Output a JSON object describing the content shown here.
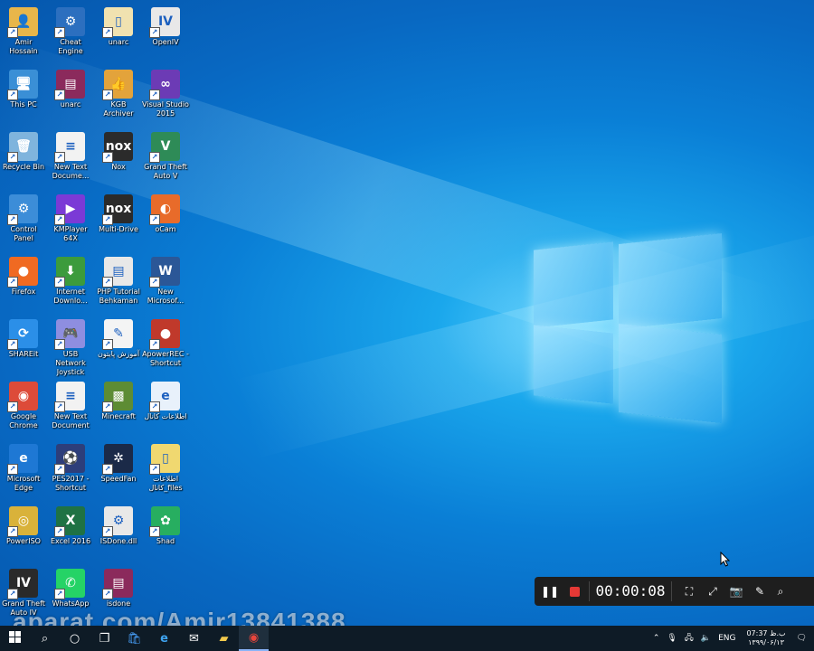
{
  "desktop": {
    "icons": [
      {
        "label": "Amir Hossain",
        "glyph": "👤",
        "color": "#e8b64a"
      },
      {
        "label": "This PC",
        "glyph": "🖥",
        "color": "#3a8fd6"
      },
      {
        "label": "Recycle Bin",
        "glyph": "🗑",
        "color": "#7fb4dd"
      },
      {
        "label": "Control Panel",
        "glyph": "⚙",
        "color": "#3c8dd8"
      },
      {
        "label": "Firefox",
        "glyph": "●",
        "color": "#f06a22"
      },
      {
        "label": "SHAREit",
        "glyph": "⟳",
        "color": "#2b8fe8"
      },
      {
        "label": "Google Chrome",
        "glyph": "◉",
        "color": "#dd4b39"
      },
      {
        "label": "Microsoft Edge",
        "glyph": "e",
        "color": "#1e78d4"
      },
      {
        "label": "PowerISO",
        "glyph": "◎",
        "color": "#d9b23a"
      },
      {
        "label": "Grand Theft Auto IV",
        "glyph": "IV",
        "color": "#2a2a2a"
      },
      {
        "label": "Cheat Engine",
        "glyph": "⚙",
        "color": "#2c6fbf"
      },
      {
        "label": "unarc",
        "glyph": "▤",
        "color": "#8b2a5c"
      },
      {
        "label": "New Text Docume...",
        "glyph": "≡",
        "color": "#f2f2f2"
      },
      {
        "label": "KMPlayer 64X",
        "glyph": "▶",
        "color": "#7b3ad6"
      },
      {
        "label": "Internet Downlo...",
        "glyph": "⬇",
        "color": "#3c9b3c"
      },
      {
        "label": "USB Network Joystick",
        "glyph": "🎮",
        "color": "#8e8ee0"
      },
      {
        "label": "New Text Document",
        "glyph": "≡",
        "color": "#f2f2f2"
      },
      {
        "label": "PES2017 - Shortcut",
        "glyph": "⚽",
        "color": "#2d3e7a"
      },
      {
        "label": "Excel 2016",
        "glyph": "X",
        "color": "#1f7244"
      },
      {
        "label": "WhatsApp",
        "glyph": "✆",
        "color": "#25d366"
      },
      {
        "label": "unarc",
        "glyph": "▯",
        "color": "#f0e2b0"
      },
      {
        "label": "KGB Archiver",
        "glyph": "👍",
        "color": "#e3a33b"
      },
      {
        "label": "Nox",
        "glyph": "nox",
        "color": "#2b2b2b"
      },
      {
        "label": "Multi-Drive",
        "glyph": "nox",
        "color": "#2b2b2b"
      },
      {
        "label": "PHP Tutorial Behkaman",
        "glyph": "▤",
        "color": "#e8e8e8"
      },
      {
        "label": "آموزش پایتون",
        "glyph": "✎",
        "color": "#f4f4f4"
      },
      {
        "label": "Minecraft",
        "glyph": "▩",
        "color": "#5d8c34"
      },
      {
        "label": "SpeedFan",
        "glyph": "✲",
        "color": "#1b2a48"
      },
      {
        "label": "ISDone.dll",
        "glyph": "⚙",
        "color": "#e8e8e8"
      },
      {
        "label": "isdone",
        "glyph": "▤",
        "color": "#8b2a5c"
      },
      {
        "label": "OpenIV",
        "glyph": "IV",
        "color": "#e8e8e8"
      },
      {
        "label": "Visual Studio 2015",
        "glyph": "∞",
        "color": "#6c3bb5"
      },
      {
        "label": "Grand Theft Auto V",
        "glyph": "V",
        "color": "#2e8b57"
      },
      {
        "label": "oCam",
        "glyph": "◐",
        "color": "#e86b2a"
      },
      {
        "label": "New Microsof...",
        "glyph": "W",
        "color": "#2b5797"
      },
      {
        "label": "ApowerREC - Shortcut",
        "glyph": "●",
        "color": "#c0392b"
      },
      {
        "label": "اطلاعات كانال",
        "glyph": "e",
        "color": "#e8f1fb"
      },
      {
        "label": "اطلاعات كانال_files",
        "glyph": "▯",
        "color": "#f0d870"
      },
      {
        "label": "Shad",
        "glyph": "✿",
        "color": "#27ae60"
      }
    ]
  },
  "recorder": {
    "timer": "00:00:08",
    "pause_glyph": "❚❚",
    "stop_color": "#e53935"
  },
  "watermark": "aparat.com/Amir13841388",
  "taskbar": {
    "lang": "ENG",
    "clock_time": "07:37 ب.ظ",
    "clock_date": "۱۳۹۹/۰۶/۱۳"
  }
}
